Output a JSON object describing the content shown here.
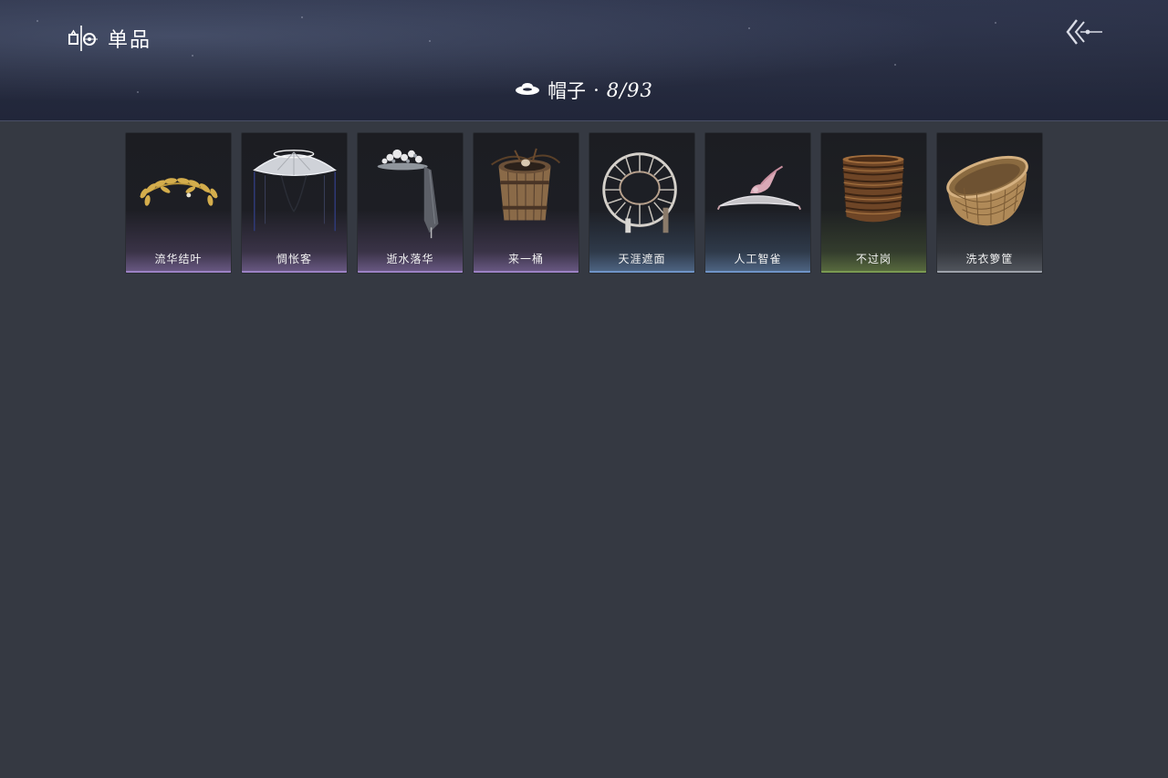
{
  "header": {
    "title": "单品",
    "title_icon": "wardrobe-icon",
    "back_icon": "back-arrow-icon"
  },
  "category": {
    "icon": "hat-icon",
    "label": "帽子",
    "separator": "·",
    "count": "8/93"
  },
  "items": [
    {
      "name": "流华结叶",
      "rarity": "purple",
      "icon": "laurel-wreath-icon"
    },
    {
      "name": "惆怅客",
      "rarity": "purple",
      "icon": "veiled-straw-hat-icon"
    },
    {
      "name": "逝水落华",
      "rarity": "purple",
      "icon": "flower-hat-icon"
    },
    {
      "name": "来一桶",
      "rarity": "purple",
      "icon": "wooden-bucket-icon"
    },
    {
      "name": "天涯遮面",
      "rarity": "blue",
      "icon": "rattan-hat-icon"
    },
    {
      "name": "人工智雀",
      "rarity": "blue",
      "icon": "bird-hat-icon"
    },
    {
      "name": "不过岗",
      "rarity": "green",
      "icon": "bowl-stack-icon"
    },
    {
      "name": "洗衣箩筐",
      "rarity": "white",
      "icon": "basket-icon"
    }
  ],
  "colors": {
    "background": "#353942",
    "header": "#252a3d",
    "purple": "#9c82c4",
    "blue": "#6f93c7",
    "green": "#7a9a52",
    "white": "#9da2ab"
  }
}
